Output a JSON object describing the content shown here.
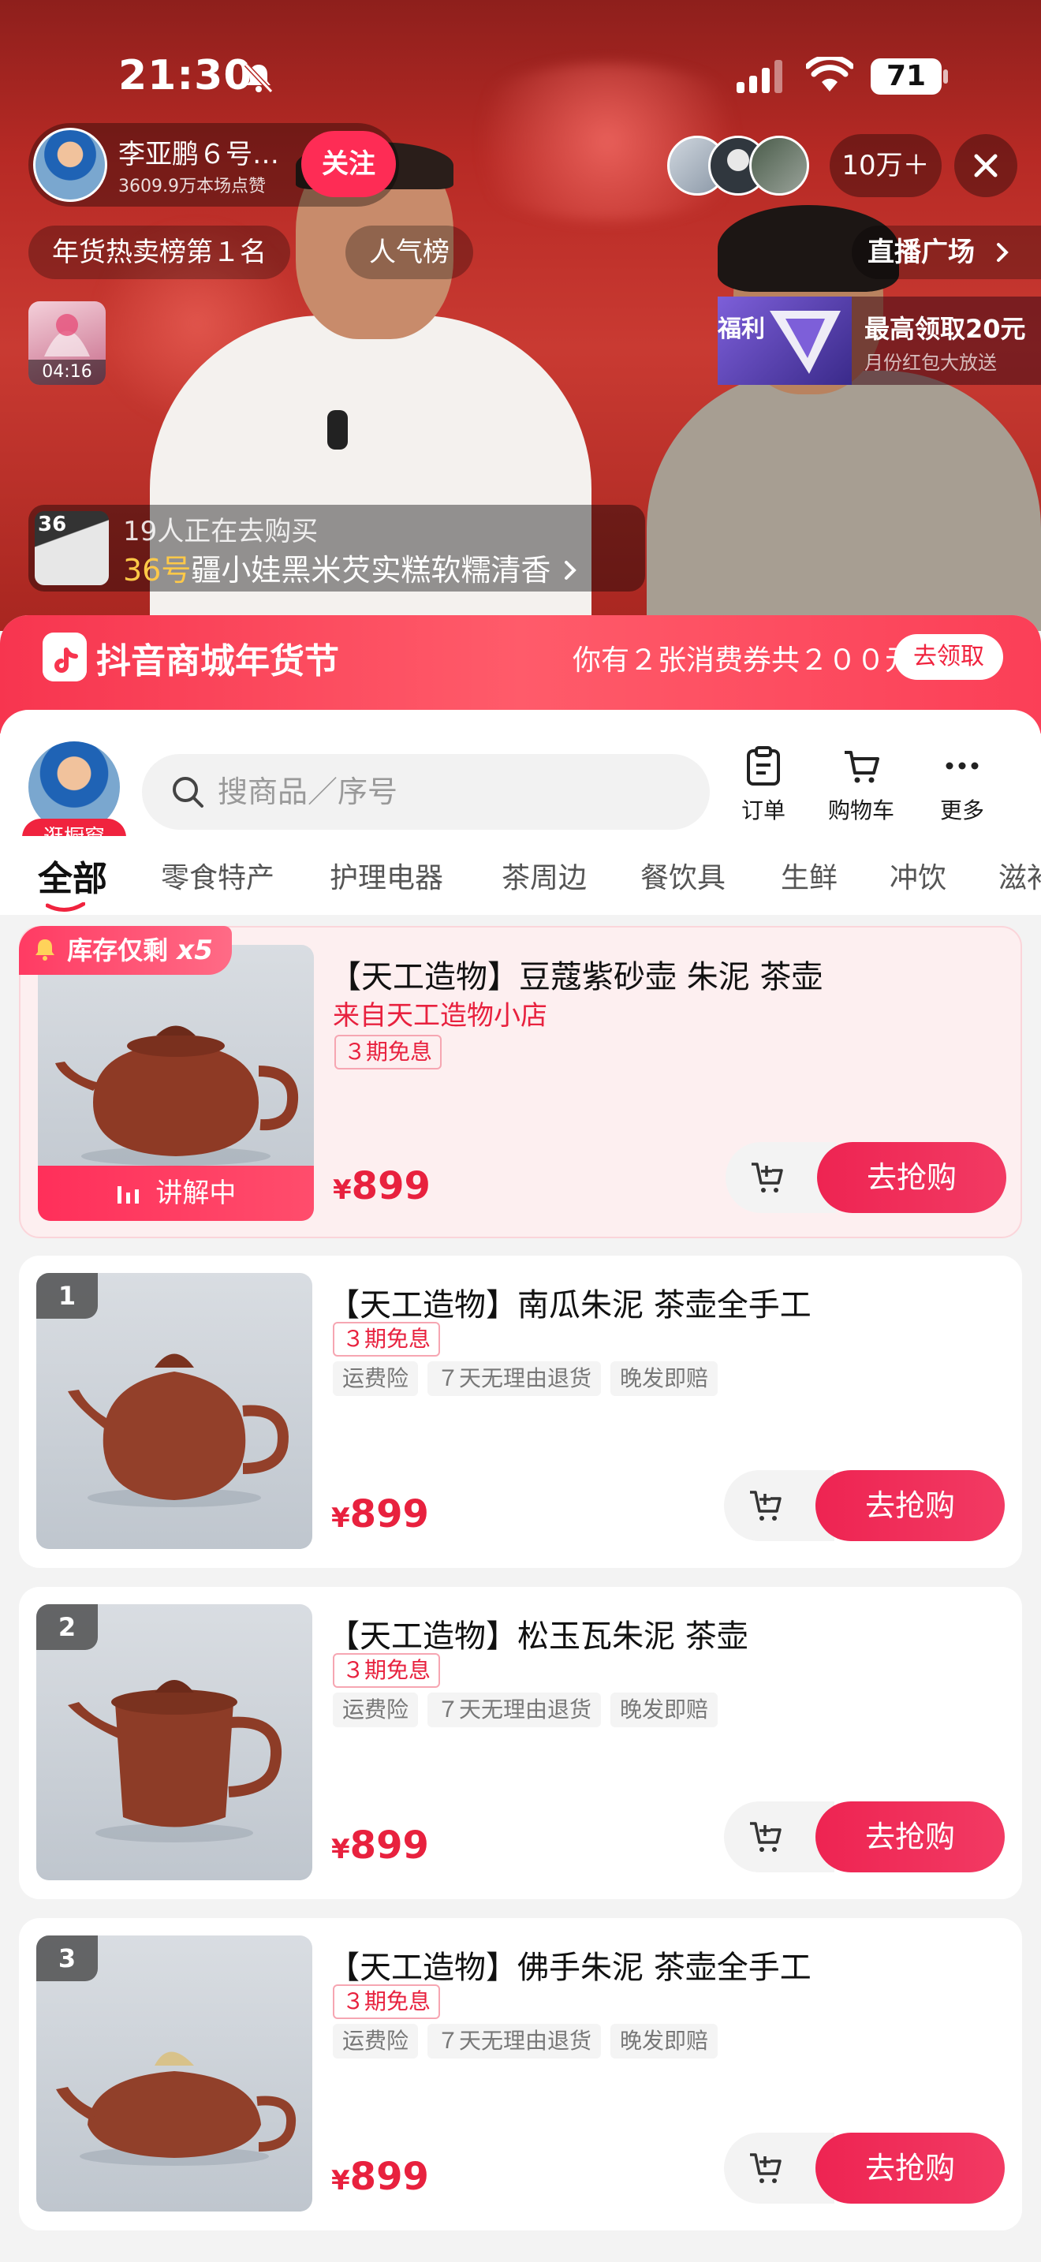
{
  "status_bar": {
    "time": "21:30",
    "battery": "71"
  },
  "live": {
    "host_name": "李亚鹏６号…",
    "likes": "3609.9万本场点赞",
    "follow_label": "关注",
    "viewer_count": "10万＋",
    "tags": [
      "年货热卖榜第１名",
      "人气榜"
    ],
    "plaza_label": "直播广场",
    "mini_video_duration": "04:16",
    "banner": {
      "left_text": "福利",
      "title": "最高领取20元",
      "subtitle": "月份红包大放送"
    },
    "buying": {
      "thumb_number": "36",
      "count_text": "19人正在去购买",
      "item_no": "36号",
      "item_name": "疆小娃黑米芡实糕软糯清香"
    }
  },
  "shop": {
    "festival_title": "抖音商城年货节",
    "coupon_text": "你有２张消费券共２００元",
    "coupon_button": "去领取",
    "shop_label": "逛橱窗",
    "search_placeholder": "搜商品／序号",
    "tools": {
      "orders": "订单",
      "cart": "购物车",
      "more": "更多"
    },
    "categories": [
      "全部",
      "零食特产",
      "护理电器",
      "茶周边",
      "餐饮具",
      "生鲜",
      "冲饮",
      "滋补"
    ]
  },
  "products": [
    {
      "title": "【天工造物】豆蔻紫砂壶 朱泥 茶壶",
      "shop": "来自天工造物小店",
      "installment": "３期免息",
      "price_symbol": "¥",
      "price": "899",
      "stock_label": "库存仅剩",
      "stock_count": "x5",
      "live_label": "讲解中",
      "buy_label": "去抢购"
    },
    {
      "rank": "1",
      "title": "【天工造物】南瓜朱泥 茶壶全手工",
      "installment": "３期免息",
      "services": [
        "运费险",
        "７天无理由退货",
        "晚发即赔"
      ],
      "price_symbol": "¥",
      "price": "899",
      "buy_label": "去抢购"
    },
    {
      "rank": "2",
      "title": "【天工造物】松玉瓦朱泥 茶壶",
      "installment": "３期免息",
      "services": [
        "运费险",
        "７天无理由退货",
        "晚发即赔"
      ],
      "price_symbol": "¥",
      "price": "899",
      "buy_label": "去抢购"
    },
    {
      "rank": "3",
      "title": "【天工造物】佛手朱泥 茶壶全手工",
      "installment": "３期免息",
      "services": [
        "运费险",
        "７天无理由退货",
        "晚发即赔"
      ],
      "price_symbol": "¥",
      "price": "899",
      "buy_label": "去抢购"
    }
  ],
  "colors": {
    "accent": "#fe2c55",
    "price": "#e8213e",
    "festival": "#f7354f"
  },
  "icons": [
    "bell-mute-icon",
    "signal-icon",
    "wifi-icon",
    "close-icon",
    "search-icon",
    "order-icon",
    "cart-icon",
    "more-icon",
    "add-cart-icon",
    "chevron-right-icon",
    "bars-icon",
    "douyin-bag-icon"
  ]
}
